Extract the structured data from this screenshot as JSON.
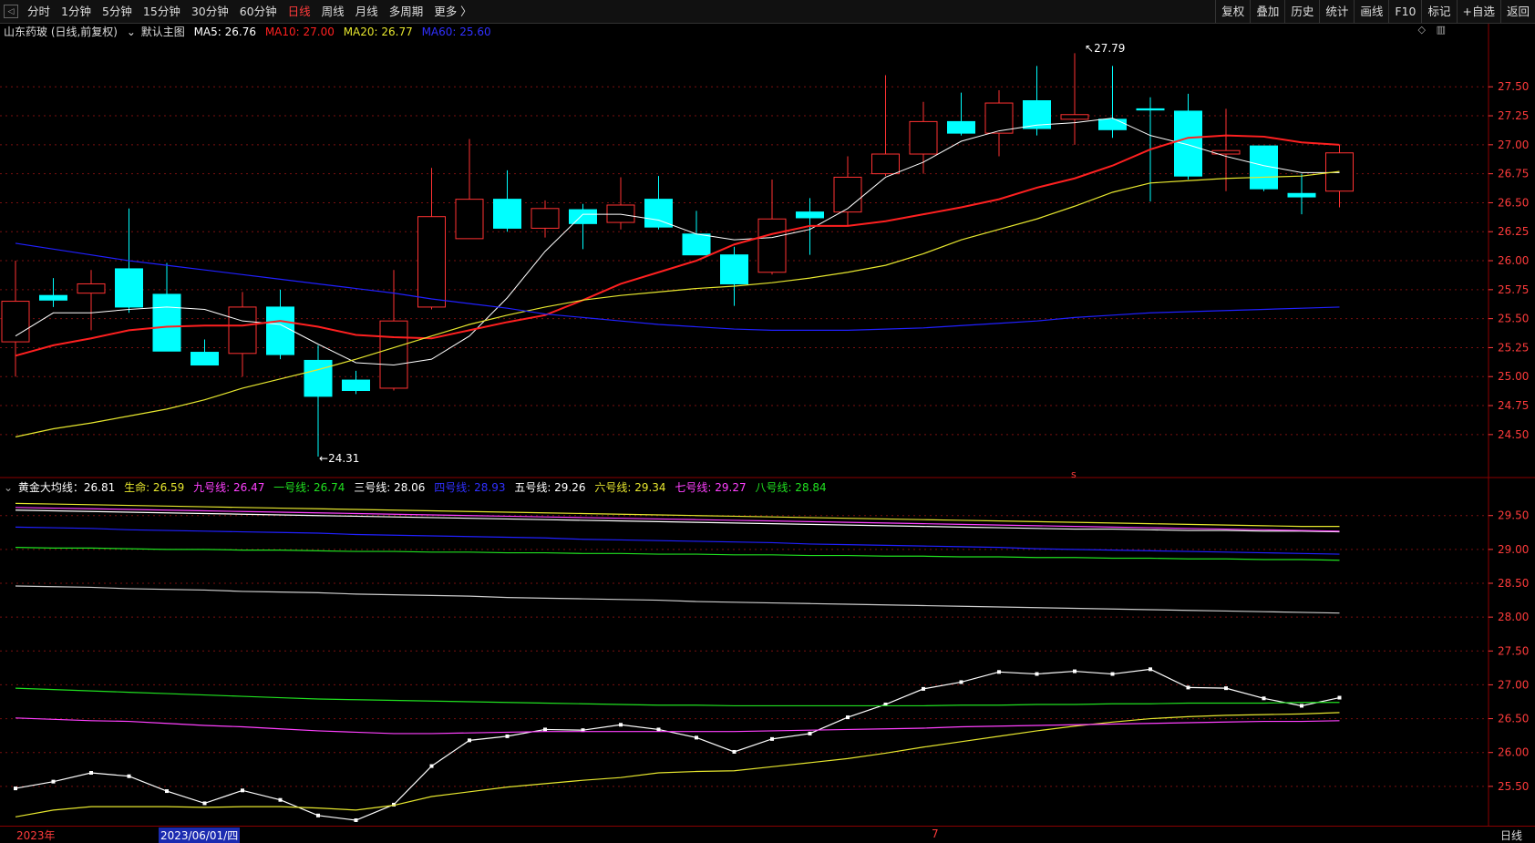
{
  "toolbar": {
    "left_tabs": [
      "分时",
      "1分钟",
      "5分钟",
      "15分钟",
      "30分钟",
      "60分钟",
      "日线",
      "周线",
      "月线",
      "多周期",
      "更多 〉"
    ],
    "active_tab": "日线",
    "right_buttons": [
      "复权",
      "叠加",
      "历史",
      "统计",
      "画线",
      "F10",
      "标记",
      "+自选",
      "返回"
    ]
  },
  "main_legend": {
    "stock": "山东药玻 (日线,前复权)",
    "template": "默认主图",
    "ma5": "MA5: 26.76",
    "ma10": "MA10: 27.00",
    "ma20": "MA20: 26.77",
    "ma60": "MA60: 25.60"
  },
  "sub_legend": {
    "gold": "黄金大均线：26.81",
    "life": "生命: 26.59",
    "l9": "九号线: 26.47",
    "l1": "一号线: 26.74",
    "l3": "三号线: 28.06",
    "l4": "四号线: 28.93",
    "l5": "五号线: 29.26",
    "l6": "六号线: 29.34",
    "l7": "七号线: 29.27",
    "l8": "八号线: 28.84"
  },
  "footer": {
    "year": "2023年",
    "date": "2023/06/01/四",
    "month_mark": "7",
    "period": "日线"
  },
  "colors": {
    "up": "#ff3232",
    "down": "#00ffff",
    "ma5": "#ffffff",
    "ma10": "#ff2020",
    "ma20": "#e6e62e",
    "ma60": "#2020ff",
    "axis": "#ff3b3b",
    "grid": "#7a1010"
  },
  "chart_data": [
    {
      "type": "candlestick",
      "title": "山东药玻 (日线,前复权)",
      "ylim": [
        24.2,
        27.95
      ],
      "y_ticks": [
        24.5,
        24.75,
        25.0,
        25.25,
        25.5,
        25.75,
        26.0,
        26.25,
        26.5,
        26.75,
        27.0,
        27.25,
        27.5
      ],
      "annotations": [
        {
          "text": "27.79"
        },
        {
          "text": "24.31"
        }
      ],
      "candles": [
        {
          "o": 25.3,
          "h": 26.0,
          "l": 25.0,
          "c": 25.65
        },
        {
          "o": 25.7,
          "h": 25.85,
          "l": 25.6,
          "c": 25.66
        },
        {
          "o": 25.72,
          "h": 25.92,
          "l": 25.4,
          "c": 25.8
        },
        {
          "o": 25.93,
          "h": 26.45,
          "l": 25.55,
          "c": 25.6
        },
        {
          "o": 25.71,
          "h": 25.98,
          "l": 25.22,
          "c": 25.22
        },
        {
          "o": 25.21,
          "h": 25.32,
          "l": 25.1,
          "c": 25.1
        },
        {
          "o": 25.2,
          "h": 25.73,
          "l": 25.0,
          "c": 25.6
        },
        {
          "o": 25.6,
          "h": 25.75,
          "l": 25.15,
          "c": 25.19
        },
        {
          "o": 25.14,
          "h": 25.27,
          "l": 24.31,
          "c": 24.83
        },
        {
          "o": 24.97,
          "h": 25.05,
          "l": 24.85,
          "c": 24.88
        },
        {
          "o": 24.9,
          "h": 25.92,
          "l": 24.88,
          "c": 25.48
        },
        {
          "o": 25.6,
          "h": 26.8,
          "l": 25.58,
          "c": 26.38
        },
        {
          "o": 26.19,
          "h": 27.05,
          "l": 26.19,
          "c": 26.53
        },
        {
          "o": 26.53,
          "h": 26.78,
          "l": 26.25,
          "c": 26.28
        },
        {
          "o": 26.28,
          "h": 26.52,
          "l": 26.2,
          "c": 26.45
        },
        {
          "o": 26.44,
          "h": 26.49,
          "l": 26.1,
          "c": 26.32
        },
        {
          "o": 26.33,
          "h": 26.72,
          "l": 26.27,
          "c": 26.48
        },
        {
          "o": 26.53,
          "h": 26.73,
          "l": 26.27,
          "c": 26.29
        },
        {
          "o": 26.23,
          "h": 26.43,
          "l": 26.05,
          "c": 26.05
        },
        {
          "o": 26.05,
          "h": 26.12,
          "l": 25.61,
          "c": 25.8
        },
        {
          "o": 25.9,
          "h": 26.7,
          "l": 25.88,
          "c": 26.36
        },
        {
          "o": 26.42,
          "h": 26.54,
          "l": 26.05,
          "c": 26.37
        },
        {
          "o": 26.42,
          "h": 26.9,
          "l": 26.3,
          "c": 26.72
        },
        {
          "o": 26.75,
          "h": 27.6,
          "l": 26.73,
          "c": 26.92
        },
        {
          "o": 26.92,
          "h": 27.37,
          "l": 26.75,
          "c": 27.2
        },
        {
          "o": 27.2,
          "h": 27.45,
          "l": 27.08,
          "c": 27.1
        },
        {
          "o": 27.1,
          "h": 27.47,
          "l": 26.9,
          "c": 27.36
        },
        {
          "o": 27.38,
          "h": 27.68,
          "l": 27.08,
          "c": 27.14
        },
        {
          "o": 27.22,
          "h": 27.79,
          "l": 27.0,
          "c": 27.26
        },
        {
          "o": 27.22,
          "h": 27.68,
          "l": 27.06,
          "c": 27.13
        },
        {
          "o": 27.31,
          "h": 27.41,
          "l": 26.51,
          "c": 27.3
        },
        {
          "o": 27.29,
          "h": 27.44,
          "l": 26.7,
          "c": 26.73
        },
        {
          "o": 26.92,
          "h": 27.31,
          "l": 26.6,
          "c": 26.95
        },
        {
          "o": 26.99,
          "h": 26.99,
          "l": 26.6,
          "c": 26.62
        },
        {
          "o": 26.58,
          "h": 26.75,
          "l": 26.4,
          "c": 26.55
        },
        {
          "o": 26.6,
          "h": 27.0,
          "l": 26.46,
          "c": 26.93
        }
      ],
      "series": [
        {
          "name": "MA5",
          "values": [
            25.35,
            25.55,
            25.55,
            25.58,
            25.6,
            25.58,
            25.48,
            25.45,
            25.28,
            25.12,
            25.1,
            25.15,
            25.35,
            25.68,
            26.08,
            26.4,
            26.4,
            26.35,
            26.23,
            26.18,
            26.2,
            26.27,
            26.45,
            26.72,
            26.85,
            27.03,
            27.12,
            27.17,
            27.19,
            27.23,
            27.08,
            27.0,
            26.9,
            26.82,
            26.76,
            26.76
          ]
        },
        {
          "name": "MA10",
          "values": [
            25.18,
            25.27,
            25.33,
            25.4,
            25.43,
            25.44,
            25.44,
            25.48,
            25.43,
            25.36,
            25.34,
            25.33,
            25.4,
            25.47,
            25.53,
            25.66,
            25.8,
            25.9,
            26.0,
            26.14,
            26.23,
            26.3,
            26.3,
            26.34,
            26.4,
            26.46,
            26.53,
            26.63,
            26.71,
            26.82,
            26.96,
            27.06,
            27.08,
            27.07,
            27.02,
            27.0
          ]
        },
        {
          "name": "MA20",
          "values": [
            24.48,
            24.55,
            24.6,
            24.66,
            24.72,
            24.8,
            24.9,
            24.98,
            25.06,
            25.15,
            25.25,
            25.35,
            25.45,
            25.53,
            25.6,
            25.66,
            25.7,
            25.73,
            25.76,
            25.78,
            25.81,
            25.85,
            25.9,
            25.96,
            26.06,
            26.18,
            26.27,
            26.36,
            26.47,
            26.59,
            26.67,
            26.69,
            26.71,
            26.72,
            26.73,
            26.77
          ]
        },
        {
          "name": "MA60",
          "values": [
            26.15,
            26.1,
            26.05,
            26.0,
            25.96,
            25.92,
            25.88,
            25.84,
            25.8,
            25.76,
            25.72,
            25.67,
            25.63,
            25.59,
            25.54,
            25.51,
            25.48,
            25.45,
            25.43,
            25.41,
            25.4,
            25.4,
            25.4,
            25.41,
            25.42,
            25.44,
            25.46,
            25.48,
            25.51,
            25.53,
            25.55,
            25.56,
            25.57,
            25.58,
            25.59,
            25.6
          ]
        }
      ]
    },
    {
      "type": "line",
      "title": "黄金大均线",
      "ylim": [
        25.0,
        29.9
      ],
      "y_ticks": [
        25.5,
        26.0,
        26.5,
        27.0,
        27.5,
        28.0,
        28.5,
        29.0,
        29.5
      ],
      "series": [
        {
          "name": "黄金大均线",
          "values": [
            25.47,
            25.57,
            25.7,
            25.65,
            25.43,
            25.25,
            25.44,
            25.3,
            25.07,
            25.0,
            25.23,
            25.8,
            26.18,
            26.24,
            26.34,
            26.33,
            26.41,
            26.34,
            26.22,
            26.01,
            26.2,
            26.28,
            26.52,
            26.71,
            26.94,
            27.04,
            27.19,
            27.16,
            27.2,
            27.16,
            27.23,
            26.96,
            26.95,
            26.8,
            26.69,
            26.81
          ]
        },
        {
          "name": "生命",
          "values": [
            25.05,
            25.15,
            25.2,
            25.2,
            25.2,
            25.19,
            25.2,
            25.2,
            25.18,
            25.15,
            25.22,
            25.35,
            25.42,
            25.49,
            25.54,
            25.59,
            25.63,
            25.7,
            25.72,
            25.73,
            25.79,
            25.85,
            25.91,
            25.99,
            26.08,
            26.16,
            26.24,
            26.32,
            26.39,
            26.45,
            26.5,
            26.53,
            26.55,
            26.56,
            26.57,
            26.59
          ]
        },
        {
          "name": "九号线",
          "values": [
            26.51,
            26.49,
            26.47,
            26.46,
            26.43,
            26.4,
            26.38,
            26.35,
            26.32,
            26.3,
            26.28,
            26.28,
            26.29,
            26.3,
            26.31,
            26.31,
            26.31,
            26.31,
            26.31,
            26.31,
            26.32,
            26.33,
            26.34,
            26.35,
            26.36,
            26.38,
            26.39,
            26.4,
            26.41,
            26.42,
            26.43,
            26.44,
            26.45,
            26.46,
            26.46,
            26.47
          ]
        },
        {
          "name": "一号线",
          "values": [
            26.95,
            26.93,
            26.91,
            26.89,
            26.87,
            26.85,
            26.83,
            26.81,
            26.79,
            26.78,
            26.77,
            26.76,
            26.75,
            26.74,
            26.73,
            26.72,
            26.71,
            26.7,
            26.7,
            26.69,
            26.69,
            26.69,
            26.69,
            26.69,
            26.69,
            26.7,
            26.7,
            26.71,
            26.71,
            26.72,
            26.72,
            26.73,
            26.73,
            26.73,
            26.74,
            26.74
          ]
        },
        {
          "name": "三号线",
          "values": [
            28.46,
            28.45,
            28.44,
            28.42,
            28.41,
            28.4,
            28.38,
            28.37,
            28.36,
            28.34,
            28.33,
            28.32,
            28.31,
            28.29,
            28.28,
            28.27,
            28.26,
            28.25,
            28.23,
            28.22,
            28.21,
            28.2,
            28.19,
            28.18,
            28.17,
            28.16,
            28.15,
            28.14,
            28.13,
            28.12,
            28.11,
            28.1,
            28.09,
            28.08,
            28.07,
            28.06
          ]
        },
        {
          "name": "八号线",
          "values": [
            29.03,
            29.02,
            29.02,
            29.01,
            29.0,
            29.0,
            28.99,
            28.99,
            28.98,
            28.97,
            28.97,
            28.96,
            28.96,
            28.95,
            28.95,
            28.94,
            28.94,
            28.93,
            28.93,
            28.92,
            28.92,
            28.91,
            28.91,
            28.9,
            28.9,
            28.89,
            28.89,
            28.88,
            28.88,
            28.87,
            28.87,
            28.86,
            28.86,
            28.85,
            28.85,
            28.84
          ]
        },
        {
          "name": "四号线",
          "values": [
            29.33,
            29.32,
            29.31,
            29.29,
            29.28,
            29.27,
            29.26,
            29.25,
            29.24,
            29.22,
            29.21,
            29.2,
            29.19,
            29.18,
            29.17,
            29.15,
            29.14,
            29.13,
            29.12,
            29.11,
            29.1,
            29.08,
            29.07,
            29.06,
            29.05,
            29.04,
            29.03,
            29.01,
            29.0,
            28.99,
            28.98,
            28.97,
            28.96,
            28.95,
            28.94,
            28.93
          ]
        },
        {
          "name": "五号线",
          "values": [
            29.58,
            29.57,
            29.56,
            29.55,
            29.54,
            29.53,
            29.52,
            29.51,
            29.5,
            29.49,
            29.48,
            29.47,
            29.46,
            29.45,
            29.44,
            29.43,
            29.42,
            29.41,
            29.4,
            29.39,
            29.38,
            29.37,
            29.36,
            29.35,
            29.34,
            29.33,
            29.32,
            29.31,
            29.3,
            29.3,
            29.29,
            29.28,
            29.28,
            29.27,
            29.27,
            29.26
          ]
        },
        {
          "name": "七号线",
          "values": [
            29.62,
            29.61,
            29.6,
            29.59,
            29.58,
            29.57,
            29.56,
            29.55,
            29.54,
            29.53,
            29.52,
            29.51,
            29.5,
            29.49,
            29.48,
            29.47,
            29.46,
            29.45,
            29.44,
            29.43,
            29.42,
            29.41,
            29.4,
            29.39,
            29.38,
            29.37,
            29.36,
            29.35,
            29.34,
            29.33,
            29.32,
            29.31,
            29.3,
            29.29,
            29.28,
            29.27
          ]
        },
        {
          "name": "六号线",
          "values": [
            29.68,
            29.67,
            29.66,
            29.65,
            29.64,
            29.63,
            29.62,
            29.61,
            29.6,
            29.59,
            29.58,
            29.57,
            29.56,
            29.55,
            29.54,
            29.53,
            29.52,
            29.51,
            29.5,
            29.49,
            29.48,
            29.47,
            29.46,
            29.45,
            29.44,
            29.43,
            29.42,
            29.41,
            29.4,
            29.39,
            29.38,
            29.37,
            29.36,
            29.35,
            29.34,
            29.34
          ]
        }
      ]
    }
  ]
}
